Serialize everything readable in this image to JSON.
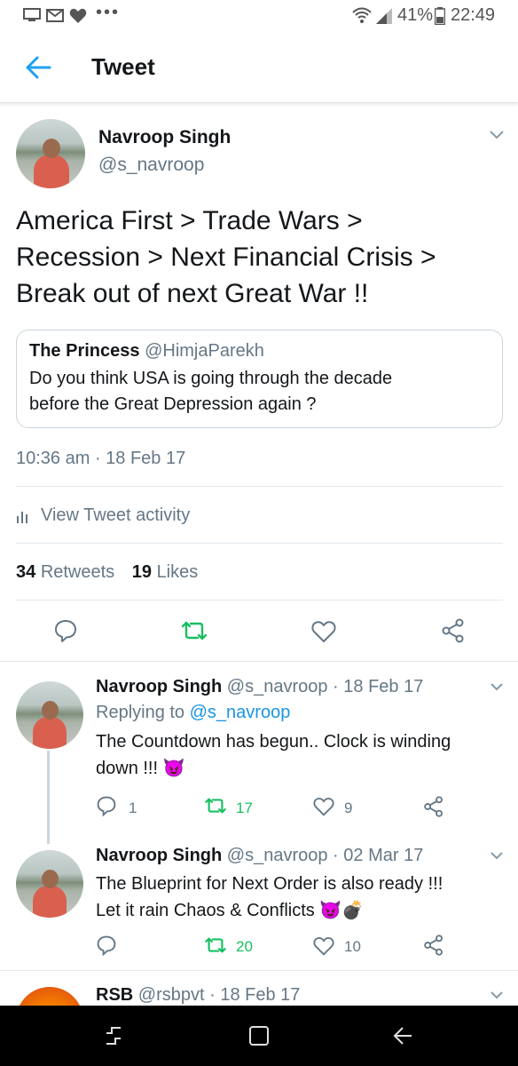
{
  "status_bar": {
    "dots": "•••",
    "battery": "41%",
    "time": "22:49"
  },
  "header": {
    "title": "Tweet"
  },
  "tweet": {
    "author_name": "Navroop Singh",
    "author_handle": "@s_navroop",
    "text_lines": [
      "America First > Trade Wars >",
      "Recession > Next Financial Crisis >",
      "Break out of next Great War !!"
    ],
    "quoted": {
      "name": "The Princess",
      "handle": "@HimjaParekh",
      "text_lines": [
        "Do you think USA is going through the decade",
        "before the Great Depression again ?"
      ]
    },
    "timestamp": "10:36 am · 18 Feb 17",
    "activity_label": "View Tweet activity",
    "retweets_count": "34",
    "retweets_label": "Retweets",
    "likes_count": "19",
    "likes_label": "Likes"
  },
  "replies": [
    {
      "name": "Navroop Singh",
      "handle_date": "@s_navroop · 18 Feb 17",
      "replying_prefix": "Replying to",
      "replying_handle": "@s_navroop",
      "text_lines": [
        "The Countdown has begun.. Clock is winding",
        "down !!! 😈"
      ],
      "reply_count": "1",
      "retweet_count": "17",
      "like_count": "9"
    },
    {
      "name": "Navroop Singh",
      "handle_date": "@s_navroop · 02 Mar 17",
      "text_lines": [
        "The Blueprint for Next Order is also ready !!!",
        "Let it rain Chaos & Conflicts 😈💣"
      ],
      "reply_count": "",
      "retweet_count": "20",
      "like_count": "10"
    },
    {
      "name": "RSB",
      "handle_date": "@rsbpvt · 18 Feb 17"
    }
  ],
  "colors": {
    "accent": "#1da1f2",
    "retweet_green": "#17bf63",
    "muted": "#657786",
    "text": "#14171a"
  }
}
